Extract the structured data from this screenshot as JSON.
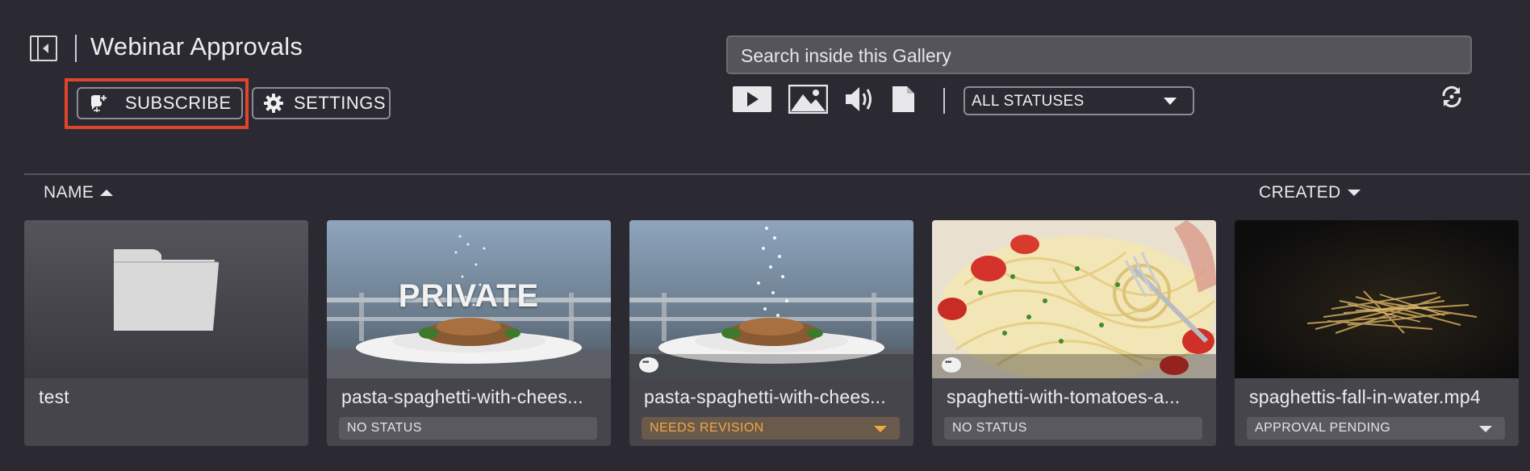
{
  "header": {
    "title": "Webinar Approvals",
    "subscribe_label": "SUBSCRIBE",
    "settings_label": "SETTINGS"
  },
  "search": {
    "placeholder": "Search inside this Gallery"
  },
  "filters": {
    "type_icons": [
      "video-icon",
      "image-icon",
      "audio-icon",
      "document-icon"
    ],
    "status_selected": "ALL STATUSES"
  },
  "sort": {
    "name_label": "NAME",
    "created_label": "CREATED"
  },
  "colors": {
    "background": "#2b2a32",
    "card": "#46454c",
    "highlight": "#e0442a",
    "needs_revision": "#f0a843"
  },
  "cards": [
    {
      "name": "test",
      "type": "folder"
    },
    {
      "name": "pasta-spaghetti-with-chees...",
      "status": "NO STATUS",
      "overlay": "PRIVATE"
    },
    {
      "name": "pasta-spaghetti-with-chees...",
      "status": "NEEDS REVISION"
    },
    {
      "name": "spaghetti-with-tomatoes-a...",
      "status": "NO STATUS"
    },
    {
      "name": "spaghettis-fall-in-water.mp4",
      "status": "APPROVAL PENDING"
    }
  ]
}
